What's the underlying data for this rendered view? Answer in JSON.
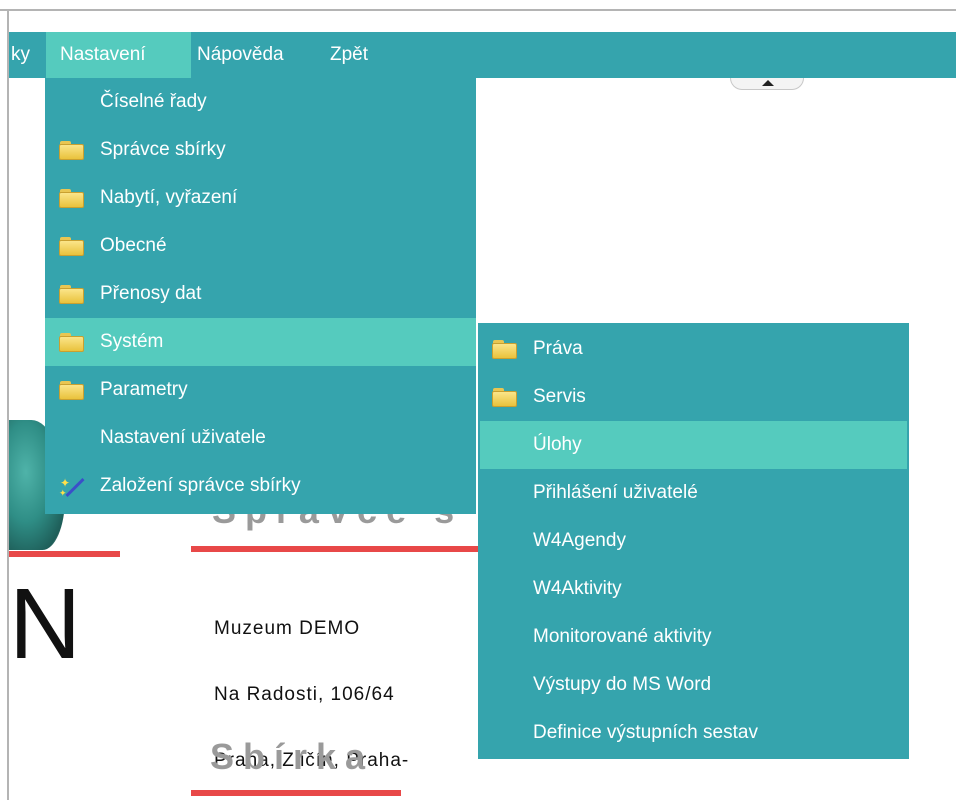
{
  "menubar": {
    "items": [
      {
        "label": "ky"
      },
      {
        "label": "Nastavení",
        "active": true
      },
      {
        "label": "Nápověda"
      },
      {
        "label": "Zpět"
      }
    ]
  },
  "settings_menu": {
    "items": [
      {
        "label": "Číselné řady",
        "icon": "none"
      },
      {
        "label": "Správce sbírky",
        "icon": "folder-icon"
      },
      {
        "label": "Nabytí, vyřazení",
        "icon": "folder-icon"
      },
      {
        "label": "Obecné",
        "icon": "folder-icon"
      },
      {
        "label": "Přenosy dat",
        "icon": "folder-icon"
      },
      {
        "label": "Systém",
        "icon": "folder-icon",
        "highlighted": true
      },
      {
        "label": "Parametry",
        "icon": "folder-icon"
      },
      {
        "label": "Nastavení uživatele",
        "icon": "none"
      },
      {
        "label": "Založení správce sbírky",
        "icon": "magic-wand-icon"
      }
    ]
  },
  "system_submenu": {
    "items": [
      {
        "label": "Práva",
        "icon": "folder-icon"
      },
      {
        "label": "Servis",
        "icon": "folder-icon"
      },
      {
        "label": "Úlohy",
        "icon": "none",
        "highlighted": true
      },
      {
        "label": "Přihlášení uživatelé",
        "icon": "none"
      },
      {
        "label": "W4Agendy",
        "icon": "none"
      },
      {
        "label": "W4Aktivity",
        "icon": "none"
      },
      {
        "label": "Monitorované aktivity",
        "icon": "none"
      },
      {
        "label": "Výstupy do MS Word",
        "icon": "none"
      },
      {
        "label": "Definice výstupních sestav",
        "icon": "none"
      }
    ]
  },
  "page": {
    "heading_partial": "Správce s",
    "big_letter": "N",
    "address_lines": [
      "Muzeum DEMO",
      "Na Radosti, 106/64",
      "Praha, Zličín, Praha-"
    ],
    "collection_heading": "Sbírka"
  },
  "colors": {
    "menu_bg": "#35a4ad",
    "menu_highlight": "#55cbbe",
    "accent_red": "#e84848"
  }
}
